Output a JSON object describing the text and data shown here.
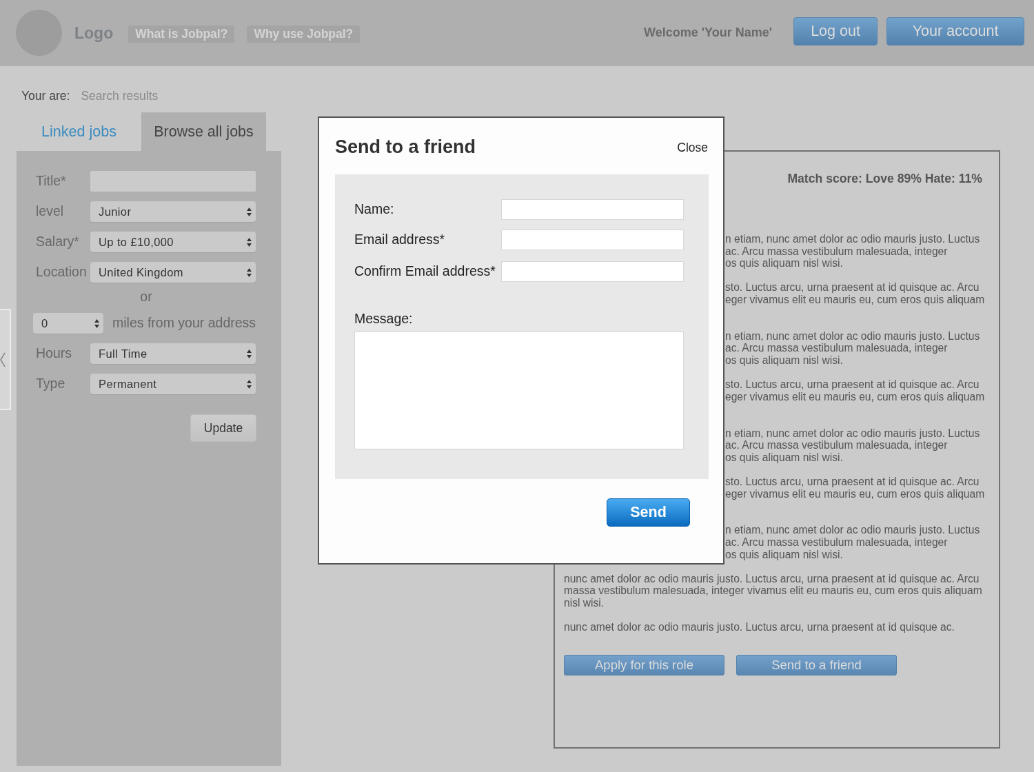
{
  "header": {
    "logo": "Logo",
    "nav_links": [
      "What is Jobpal?",
      "Why use Jobpal?"
    ],
    "welcome": "Welcome 'Your Name'",
    "buttons": [
      "Log out",
      "Your account"
    ]
  },
  "breadcrumb": {
    "label": "Your are:",
    "current": "Search results"
  },
  "tabs": [
    {
      "label": "Linked jobs",
      "selected": false
    },
    {
      "label": "Browse all jobs",
      "selected": true
    }
  ],
  "search_form": {
    "rows": [
      {
        "kind": "text",
        "label": "Title*"
      },
      {
        "kind": "select",
        "label": "level",
        "value": "Junior"
      },
      {
        "kind": "select",
        "label": "Salary*",
        "value": "Up to £10,000"
      },
      {
        "kind": "select",
        "label": "Location",
        "value": "United Kingdom"
      },
      {
        "kind": "separator",
        "text": "or"
      },
      {
        "kind": "distance",
        "value": "0",
        "suffix": "miles from your address"
      },
      {
        "kind": "select",
        "label": "Hours",
        "value": "Full Time"
      },
      {
        "kind": "select",
        "label": "Type",
        "value": "Permanent"
      }
    ],
    "button": "Update"
  },
  "job_detail": {
    "match_score": "Match score: Love 89% Hate: 11%",
    "paragraphs": [
      {
        "kind": "covered",
        "lines": [
          "n etiam, nunc amet dolor ac odio mauris justo. Luctus",
          "ac. Arcu massa vestibulum malesuada, integer",
          "os quis aliquam nisl wisi."
        ]
      },
      {
        "kind": "covered",
        "lines": [
          "sto. Luctus arcu, urna praesent at id quisque ac. Arcu",
          "eger vivamus elit eu mauris eu, cum eros quis aliquam"
        ]
      },
      {
        "kind": "covered",
        "lines": [
          "n etiam, nunc amet dolor ac odio mauris justo. Luctus",
          "ac. Arcu massa vestibulum malesuada, integer",
          "os quis aliquam nisl wisi."
        ]
      },
      {
        "kind": "covered",
        "lines": [
          "sto. Luctus arcu, urna praesent at id quisque ac. Arcu",
          "eger vivamus elit eu mauris eu, cum eros quis aliquam"
        ]
      },
      {
        "kind": "covered",
        "lines": [
          "n etiam, nunc amet dolor ac odio mauris justo. Luctus",
          "ac. Arcu massa vestibulum malesuada, integer",
          "os quis aliquam nisl wisi."
        ]
      },
      {
        "kind": "covered",
        "lines": [
          "sto. Luctus arcu, urna praesent at id quisque ac. Arcu",
          "eger vivamus elit eu mauris eu, cum eros quis aliquam"
        ]
      },
      {
        "kind": "covered",
        "lines": [
          "n etiam, nunc amet dolor ac odio mauris justo. Luctus",
          "ac. Arcu massa vestibulum malesuada, integer",
          "os quis aliquam nisl wisi."
        ]
      },
      {
        "kind": "full",
        "text": "nunc amet dolor ac odio mauris justo. Luctus arcu, urna praesent at id quisque ac. Arcu massa vestibulum malesuada, integer vivamus elit eu mauris eu, cum eros quis aliquam nisl wisi."
      },
      {
        "kind": "full",
        "text": "nunc amet dolor ac odio mauris justo. Luctus arcu, urna praesent at id quisque ac."
      }
    ],
    "buttons": [
      "Apply for this role",
      "Send to a friend"
    ]
  },
  "modal": {
    "title": "Send to a friend",
    "close": "Close",
    "fields": [
      {
        "kind": "input",
        "label": "Name:"
      },
      {
        "kind": "input",
        "label": "Email address*"
      },
      {
        "kind": "input",
        "label": "Confirm Email address*"
      },
      {
        "kind": "textarea",
        "label": "Message:"
      }
    ],
    "button": "Send"
  }
}
